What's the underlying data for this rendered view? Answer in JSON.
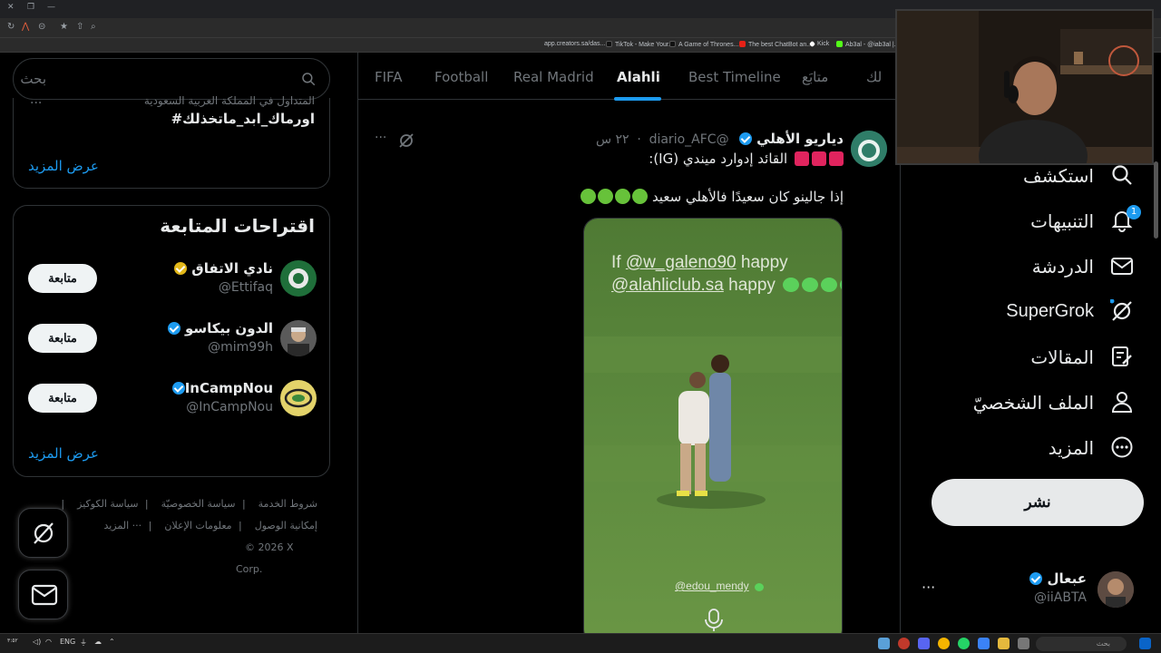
{
  "browser": {
    "bookmarks": [
      "app.creators.sa/das...",
      "TikTok - Make Your...",
      "A Game of Thrones...",
      "The best ChatBot an...",
      "Kick",
      "Ab3al - @iab3al |..."
    ]
  },
  "search": {
    "placeholder": "بحث"
  },
  "trends": {
    "context": "المتداول في المملكة العربية السعودية",
    "hashtag": "#اورماك_ابد_ماتخذلك",
    "more": "···",
    "show_more": "عرض المزيد"
  },
  "who_to_follow": {
    "title": "اقتراحات المتابعة",
    "follow_label": "متابعة",
    "accounts": [
      {
        "name": "نادي الاتفاق",
        "handle": "@Ettifaq",
        "verified": "gold"
      },
      {
        "name": "الدون بيكاسو",
        "handle": "@mim99h",
        "verified": "blue"
      },
      {
        "name": "InCampNou",
        "handle": "@InCampNou",
        "verified": "blue"
      }
    ],
    "show_more": "عرض المزيد"
  },
  "footer": {
    "links": [
      "شروط الخدمة",
      "سياسة الخصوصيّة",
      "سياسة الكوكيز",
      "إمكانية الوصول",
      "معلومات الإعلان",
      "··· المزيد"
    ],
    "copyright": "© 2026 X Corp."
  },
  "timeline_tabs": [
    {
      "label": "لك",
      "active": false
    },
    {
      "label": "متابَع",
      "active": false
    },
    {
      "label": "Best Timeline",
      "active": false
    },
    {
      "label": "Alahli",
      "active": true
    },
    {
      "label": "Real Madrid",
      "active": false
    },
    {
      "label": "Football",
      "active": false
    },
    {
      "label": "FIFA",
      "active": false
    }
  ],
  "post": {
    "author": "دياريو الأهلي",
    "handle": "@diario_AFC",
    "time": "٢٢ س",
    "line1": "القائد إدوارد ميندي (IG):",
    "line2": "إذا جالينو كان سعيدًا فالأهلي سعيد",
    "more": "···",
    "media": {
      "caption_if": "If",
      "caption_handle1": "@w_galeno90",
      "caption_happy1": "happy",
      "caption_handle2": "@alahliclub.sa",
      "caption_happy2": "happy",
      "tag": "@edou_mendy"
    }
  },
  "nav": {
    "items": [
      {
        "label": "استكشف",
        "icon": "search-icon"
      },
      {
        "label": "التنبيهات",
        "icon": "bell-icon",
        "badge": "1"
      },
      {
        "label": "الدردشة",
        "icon": "mail-icon"
      },
      {
        "label": "SuperGrok",
        "icon": "grok-icon"
      },
      {
        "label": "المقالات",
        "icon": "article-icon"
      },
      {
        "label": "الملف الشخصيّ",
        "icon": "profile-icon"
      },
      {
        "label": "المزيد",
        "icon": "more-circle-icon"
      }
    ],
    "post_button": "نشر"
  },
  "account": {
    "name": "عبعال",
    "handle": "@iiABTA",
    "more": "···"
  },
  "taskbar": {
    "search": "بحث",
    "lang": "ENG"
  },
  "colors": {
    "accent": "#1d9bf0",
    "background": "#000000",
    "text": "#e7e9ea",
    "muted": "#71767b",
    "border": "#2f3336"
  }
}
